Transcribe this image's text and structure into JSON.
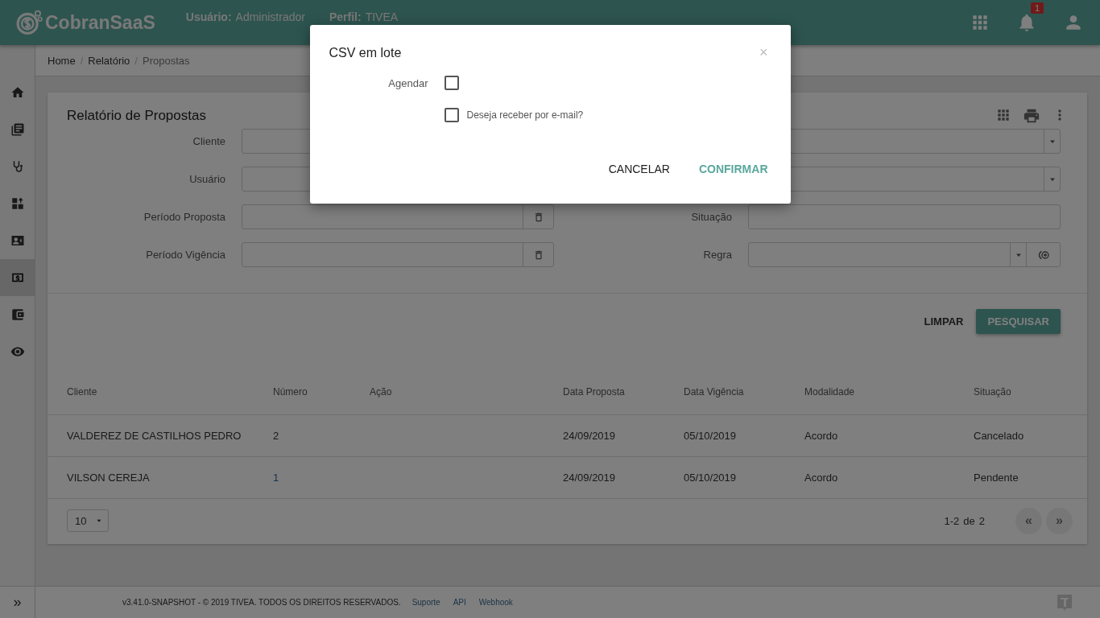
{
  "header": {
    "logo": "CobranSaaS",
    "user_label": "Usuário:",
    "user": "Administrador",
    "profile_label": "Perfil:",
    "profile": "TIVEA",
    "notification_count": "1"
  },
  "sidebar": {
    "items": [
      {
        "selected": false
      },
      {
        "selected": false
      },
      {
        "selected": false
      },
      {
        "selected": false
      },
      {
        "selected": false
      },
      {
        "selected": true
      },
      {
        "selected": false
      },
      {
        "selected": false
      }
    ]
  },
  "breadcrumb": {
    "items": [
      "Home",
      "Relatório",
      "Propostas"
    ],
    "separator": "/"
  },
  "card": {
    "title": "Relatório de Propostas",
    "left_fields": [
      {
        "label": "Cliente",
        "kind": "text"
      },
      {
        "label": "Usuário",
        "kind": "text"
      },
      {
        "label": "Período Proposta",
        "kind": "date"
      },
      {
        "label": "Período Vigência",
        "kind": "date"
      }
    ],
    "right_fields": [
      {
        "kind": "select"
      },
      {
        "kind": "select"
      },
      {
        "label": "Situação",
        "kind": "text"
      },
      {
        "label": "Regra",
        "kind": "select_action"
      }
    ],
    "buttons": [
      {
        "label": "LIMPAR",
        "kind": "flat"
      },
      {
        "label": "PESQUISAR",
        "kind": "raised"
      }
    ]
  },
  "table": {
    "columns": [
      "Cliente",
      "Número",
      "Ação",
      "Data Proposta",
      "Data Vigência",
      "Modalidade",
      "Situação"
    ],
    "rows": [
      {
        "cells": [
          "VALDEREZ DE CASTILHOS PEDRO",
          "2",
          "",
          "24/09/2019",
          "05/10/2019",
          "Acordo",
          "Cancelado"
        ],
        "number_link": false
      },
      {
        "cells": [
          "VILSON CEREJA",
          "1",
          "",
          "24/09/2019",
          "05/10/2019",
          "Acordo",
          "Pendente"
        ],
        "number_link": true
      }
    ]
  },
  "pagination": {
    "page_size": "10",
    "range": "1-2",
    "of": "de",
    "total": "2",
    "prev": "«",
    "next": "»"
  },
  "footer": {
    "expand": "»",
    "copyright": "v3.41.0-SNAPSHOT - © 2019 TIVEA. TODOS OS DIREITOS RESERVADOS.",
    "links": [
      "Suporte",
      "API",
      "Webhook"
    ]
  },
  "modal": {
    "title": "CSV em lote",
    "close": "×",
    "schedule_label": "Agendar",
    "schedule_checked": false,
    "email_label": "Deseja receber por e-mail?",
    "email_checked": false,
    "buttons": [
      {
        "label": "CANCELAR",
        "kind": "flat"
      },
      {
        "label": "CONFIRMAR",
        "kind": "primary"
      }
    ]
  }
}
